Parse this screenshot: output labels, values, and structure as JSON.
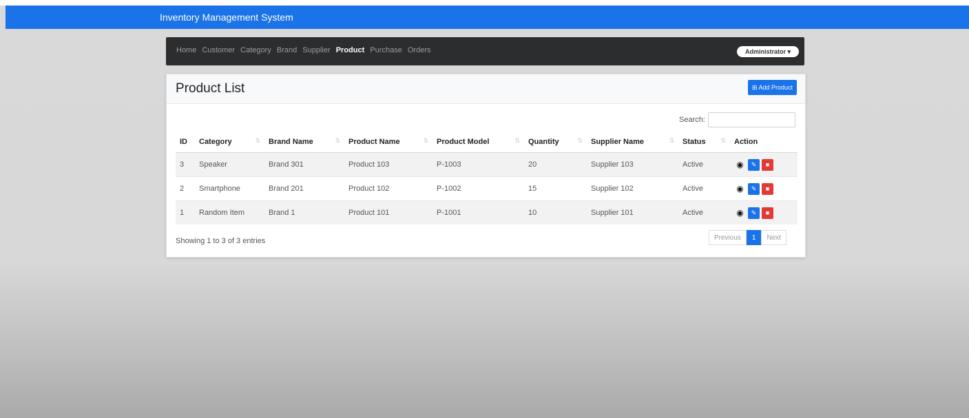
{
  "app": {
    "title": "Inventory Management System"
  },
  "nav": {
    "items": [
      {
        "label": "Home",
        "active": false
      },
      {
        "label": "Customer",
        "active": false
      },
      {
        "label": "Category",
        "active": false
      },
      {
        "label": "Brand",
        "active": false
      },
      {
        "label": "Supplier",
        "active": false
      },
      {
        "label": "Product",
        "active": true
      },
      {
        "label": "Purchase",
        "active": false
      },
      {
        "label": "Orders",
        "active": false
      }
    ],
    "user_menu": "Administrator ▾"
  },
  "card": {
    "title": "Product List",
    "add_button": "⊞ Add Product"
  },
  "search": {
    "label": "Search:",
    "value": ""
  },
  "table": {
    "columns": [
      "ID",
      "Category",
      "Brand Name",
      "Product Name",
      "Product Model",
      "Quantity",
      "Supplier Name",
      "Status",
      "Action"
    ],
    "rows": [
      [
        "3",
        "Speaker",
        "Brand 301",
        "Product 103",
        "P-1003",
        "20",
        "Supplier 103",
        "Active"
      ],
      [
        "2",
        "Smartphone",
        "Brand 201",
        "Product 102",
        "P-1002",
        "15",
        "Supplier 102",
        "Active"
      ],
      [
        "1",
        "Random Item",
        "Brand 1",
        "Product 101",
        "P-1001",
        "10",
        "Supplier 101",
        "Active"
      ]
    ]
  },
  "footer": {
    "info": "Showing 1 to 3 of 3 entries",
    "previous": "Previous",
    "page": "1",
    "next": "Next"
  },
  "colors": {
    "primary": "#1a73e8",
    "danger": "#e53935",
    "navbar": "#2b2d2f"
  }
}
